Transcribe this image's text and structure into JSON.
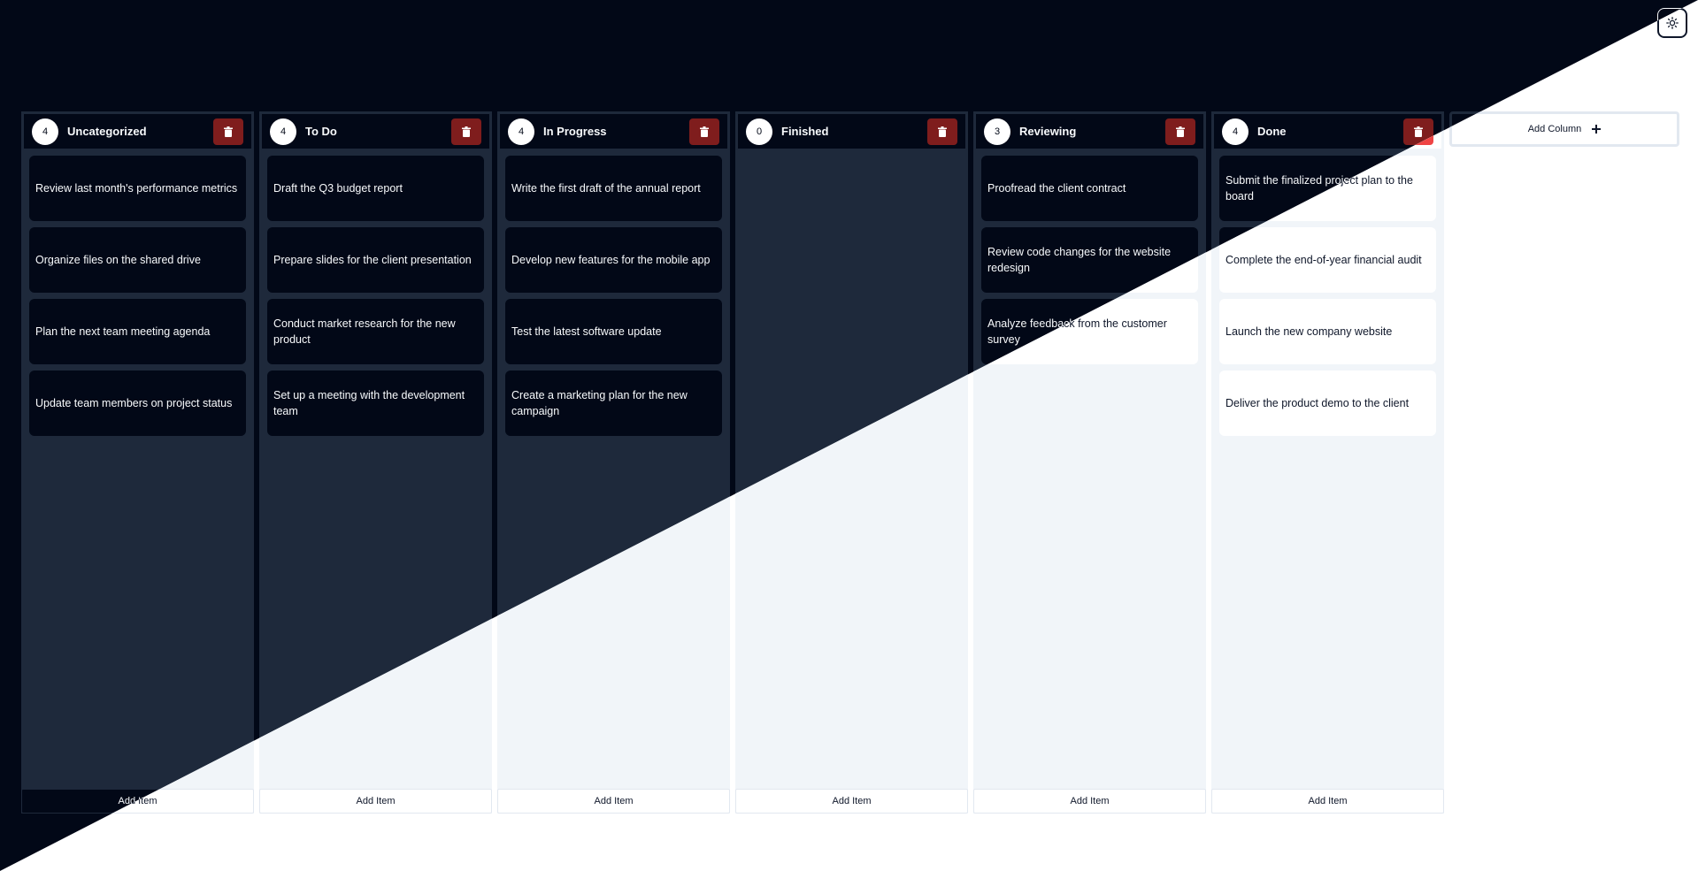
{
  "board": {
    "columns": [
      {
        "title": "Uncategorized",
        "count": "4",
        "items": [
          "Review last month's performance metrics",
          "Organize files on the shared drive",
          "Plan the next team meeting agenda",
          "Update team members on project status"
        ]
      },
      {
        "title": "To Do",
        "count": "4",
        "items": [
          "Draft the Q3 budget report",
          "Prepare slides for the client presentation",
          "Conduct market research for the new product",
          "Set up a meeting with the development team"
        ]
      },
      {
        "title": "In Progress",
        "count": "4",
        "items": [
          "Write the first draft of the annual report",
          "Develop new features for the mobile app",
          "Test the latest software update",
          "Create a marketing plan for the new campaign"
        ]
      },
      {
        "title": "Finished",
        "count": "0",
        "items": []
      },
      {
        "title": "Reviewing",
        "count": "3",
        "items": [
          "Proofread the client contract",
          "Review code changes for the website redesign",
          "Analyze feedback from the customer survey"
        ]
      },
      {
        "title": "Done",
        "count": "4",
        "items": [
          "Submit the finalized project plan to the board",
          "Complete the end-of-year financial audit",
          "Launch the new company website",
          "Deliver the product demo to the client"
        ]
      }
    ],
    "add_item_label": "Add Item",
    "add_column_label": "Add Column"
  },
  "icons": {
    "delete": "trash-icon",
    "add": "plus-icon",
    "theme": "sun-icon"
  },
  "colors": {
    "dark_bg": "#020817",
    "column_dark": "#1e293b",
    "delete_dark": "#7f1d1d",
    "delete_light": "#ef4444",
    "light_bg": "#ffffff",
    "column_light": "#f1f5f9"
  }
}
